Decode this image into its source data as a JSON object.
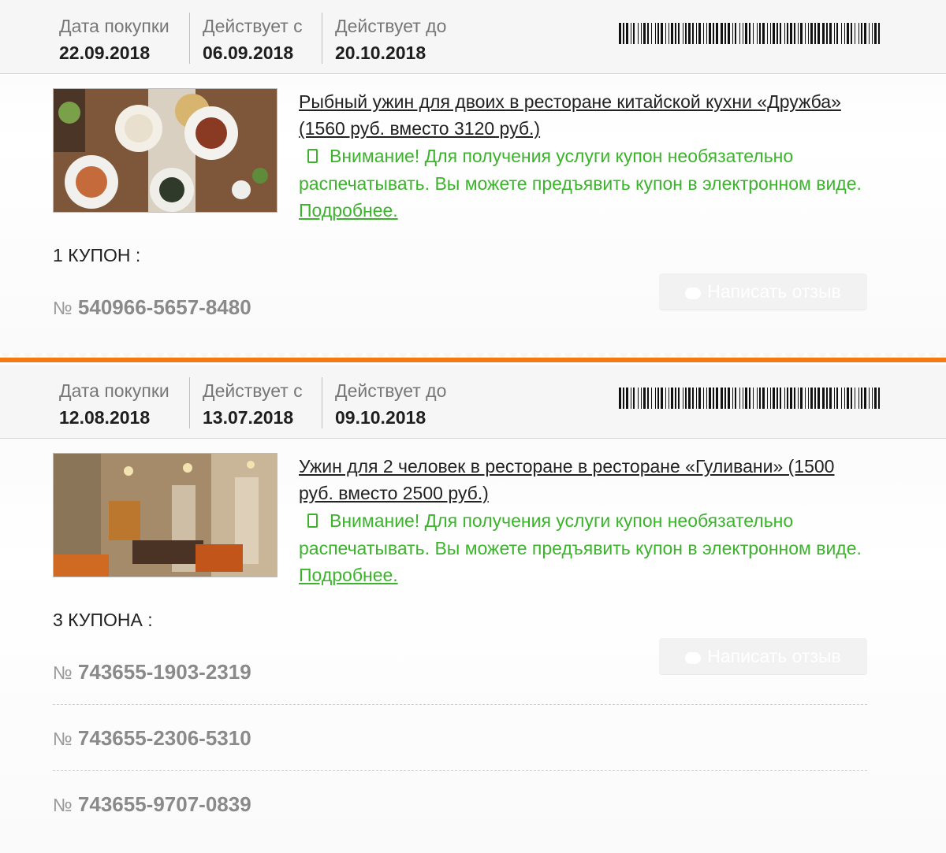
{
  "coupons": [
    {
      "purchase_label": "Дата покупки",
      "purchase_date": "22.09.2018",
      "from_label": "Действует с",
      "from_date": "06.09.2018",
      "to_label": "Действует до",
      "to_date": "20.10.2018",
      "title_line1": "Рыбный ужин для двоих в ресторане китайской кухни «Дружба»",
      "title_line2": "(1560 руб. вместо 3120 руб.)",
      "notice_text": "Внимание! Для получения услуги купон необязательно распечатывать. Вы можете предъявить купон в электронном виде.",
      "notice_link": "Подробнее.",
      "count_label": "1 КУПОН :",
      "number_prefix": "№",
      "numbers": [
        "540966-5657-8480"
      ],
      "review_button": "Написать отзыв"
    },
    {
      "purchase_label": "Дата покупки",
      "purchase_date": "12.08.2018",
      "from_label": "Действует с",
      "from_date": "13.07.2018",
      "to_label": "Действует до",
      "to_date": "09.10.2018",
      "title_line1": "Ужин для 2 человек в ресторане в ресторане «Гуливани» (1500",
      "title_line2": "руб. вместо 2500 руб.)",
      "notice_text": "Внимание! Для получения услуги купон необязательно распечатывать. Вы можете предъявить купон в электронном виде.",
      "notice_link": "Подробнее.",
      "count_label": "3 КУПОНА :",
      "number_prefix": "№",
      "numbers": [
        "743655-1903-2319",
        "743655-2306-5310",
        "743655-9707-0839"
      ],
      "review_button": "Написать отзыв"
    }
  ],
  "colors": {
    "accent_orange": "#f37a12",
    "notice_green": "#3bb42c"
  },
  "icons": [
    "barcode-icon",
    "phone-icon",
    "chat-bubble-icon"
  ]
}
